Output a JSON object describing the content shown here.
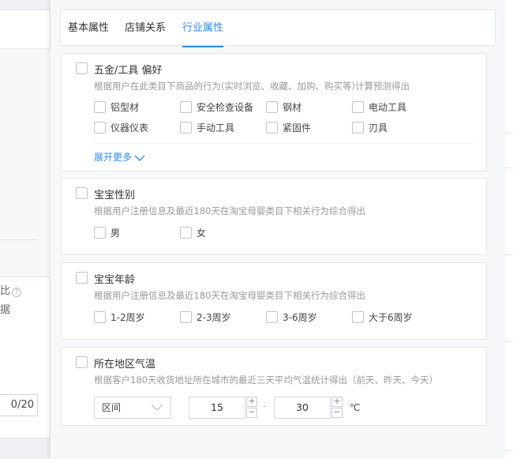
{
  "background": {
    "left_text_1": "比",
    "left_text_2": "据",
    "help_icon_glyph": "?",
    "char_count": "0/20"
  },
  "tabs": [
    {
      "label": "基本属性",
      "active": false
    },
    {
      "label": "店铺关系",
      "active": false
    },
    {
      "label": "行业属性",
      "active": true
    }
  ],
  "hardware": {
    "title": "五金/工具 偏好",
    "desc": "根据用户在此类目下商品的行为(实时浏览、收藏、加购、购买等)计算预测得出",
    "options": [
      "铝型材",
      "安全检查设备",
      "钢材",
      "电动工具",
      "仪器仪表",
      "手动工具",
      "紧固件",
      "刃具"
    ],
    "more_label": "展开更多"
  },
  "baby_gender": {
    "title": "宝宝性别",
    "desc": "根据用户注册信息及最近180天在淘宝母婴类目下相关行为综合得出",
    "options": [
      "男",
      "女"
    ]
  },
  "baby_age": {
    "title": "宝宝年龄",
    "desc": "根据用户注册信息及最近180天在淘宝母婴类目下相关行为综合得出",
    "options": [
      "1-2周岁",
      "2-3周岁",
      "3-6周岁",
      "大于6周岁"
    ]
  },
  "temperature": {
    "title": "所在地区气温",
    "desc": "根据客户180天收货地址所在城市的最近三天平均气温统计得出（前天、昨天、今天）",
    "range_select": "区间",
    "min_value": "15",
    "max_value": "30",
    "separator": "-",
    "unit": "℃",
    "plus": "+",
    "minus": "−"
  },
  "colors": {
    "accent": "#2d8cf0",
    "border": "#e3e6eb",
    "desc_text": "#999999"
  }
}
